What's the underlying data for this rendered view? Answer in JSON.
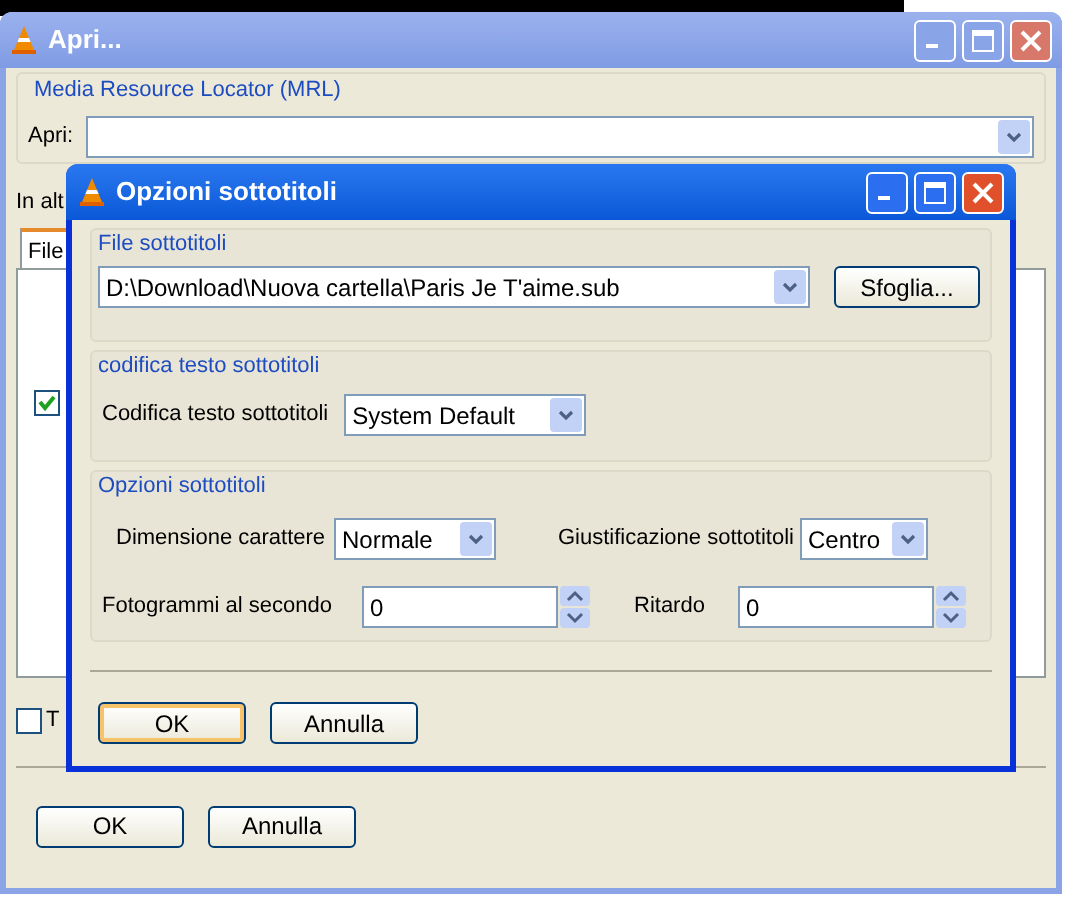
{
  "background_window": {
    "title": "Apri...",
    "mrl_group": {
      "title": "Media Resource Locator (MRL)",
      "open_label": "Apri:"
    },
    "partial_label": "In alt",
    "tabs": [
      {
        "label": "File",
        "selected": true
      }
    ],
    "checkboxes": [
      {
        "checked": true
      },
      {
        "label": "T",
        "checked": false
      }
    ],
    "buttons": [
      "OK",
      "Annulla"
    ]
  },
  "dialog": {
    "title": "Opzioni sottotitoli",
    "file_group": {
      "title": "File sottotitoli",
      "path": "D:\\Download\\Nuova cartella\\Paris Je T'aime.sub",
      "browse": "Sfoglia..."
    },
    "encoding_group": {
      "title": "codifica testo sottotitoli",
      "label": "Codifica testo sottotitoli",
      "value": "System Default"
    },
    "options_group": {
      "title": "Opzioni sottotitoli",
      "font_size_label": "Dimensione carattere",
      "font_size": "Normale",
      "justify_label": "Giustificazione sottotitoli",
      "justify": "Centro",
      "fps_label": "Fotogrammi al secondo",
      "fps": "0",
      "delay_label": "Ritardo",
      "delay": "0"
    },
    "buttons": [
      {
        "label": "OK",
        "default": true
      },
      {
        "label": "Annulla",
        "default": false
      }
    ]
  }
}
